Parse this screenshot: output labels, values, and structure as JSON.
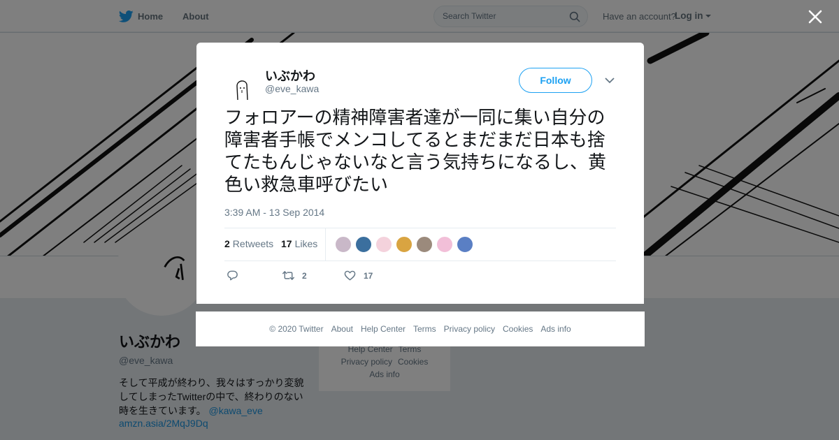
{
  "nav": {
    "home_label": "Home",
    "about_label": "About",
    "search_placeholder": "Search Twitter",
    "have_account": "Have an account?",
    "login_label": "Log in"
  },
  "profile": {
    "name": "いぶかわ",
    "handle": "@eve_kawa",
    "bio_text": "そして平成が終わり、我々はすっかり変貌してしまったTwitterの中で、終わりのない時を生きています。",
    "bio_mention": "@kawa_eve",
    "website": "amzn.asia/2MqJ9Dq"
  },
  "side_footer": {
    "links": [
      "Help Center",
      "Terms",
      "Privacy policy",
      "Cookies",
      "Ads info"
    ]
  },
  "tweet": {
    "name": "いぶかわ",
    "handle": "@eve_kawa",
    "follow_label": "Follow",
    "text": "フォロアーの精神障害者達が一同に集い自分の障害者手帳でメンコしてるとまだまだ日本も捨てたもんじゃないなと言う気持ちになるし、黄色い救急車呼びたい",
    "timestamp": "3:39 AM - 13 Sep 2014",
    "retweets_count": "2",
    "retweets_label": "Retweets",
    "likes_count": "17",
    "likes_label": "Likes",
    "action_retweets": "2",
    "action_likes": "17",
    "liker_colors": [
      "#c9b8c8",
      "#3b6f9e",
      "#f4d2dc",
      "#d9a441",
      "#9b8a7c",
      "#f2bfd8",
      "#5a7fc4"
    ]
  },
  "modal_footer": {
    "links": [
      "© 2020 Twitter",
      "About",
      "Help Center",
      "Terms",
      "Privacy policy",
      "Cookies",
      "Ads info"
    ]
  },
  "colors": {
    "accent": "#1da1f2",
    "muted": "#657786",
    "link": "#1b95e0"
  },
  "icons": [
    "twitter-bird-icon",
    "search-icon",
    "caret-down-icon",
    "close-icon",
    "chevron-down-icon",
    "reply-icon",
    "retweet-icon",
    "like-icon"
  ]
}
